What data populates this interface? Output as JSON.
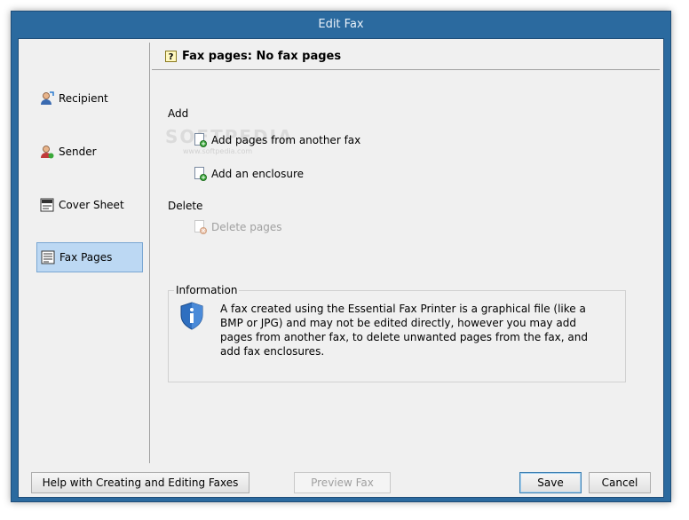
{
  "window": {
    "title": "Edit Fax"
  },
  "sidebar": {
    "items": [
      {
        "label": "Recipient",
        "icon": "recipient-icon",
        "selected": false
      },
      {
        "label": "Sender",
        "icon": "sender-icon",
        "selected": false
      },
      {
        "label": "Cover Sheet",
        "icon": "cover-sheet-icon",
        "selected": false
      },
      {
        "label": "Fax Pages",
        "icon": "fax-pages-icon",
        "selected": true
      }
    ]
  },
  "main": {
    "header": "Fax pages: No fax pages",
    "add_label": "Add",
    "actions_add": [
      {
        "label": "Add pages from another fax",
        "icon": "add-page-icon",
        "enabled": true
      },
      {
        "label": "Add an enclosure",
        "icon": "add-enclosure-icon",
        "enabled": true
      }
    ],
    "delete_label": "Delete",
    "actions_delete": [
      {
        "label": "Delete pages",
        "icon": "delete-page-icon",
        "enabled": false
      }
    ],
    "information": {
      "title": "Information",
      "text": "A fax created using the Essential Fax Printer is a graphical file (like a BMP or JPG) and may not be edited directly, however you may add pages from another fax, to delete unwanted pages from the fax, and add fax enclosures."
    }
  },
  "watermark": {
    "text": "SOFTPEDIA",
    "sub": "www.softpedia.com"
  },
  "buttons": {
    "help": "Help with Creating and Editing Faxes",
    "preview": "Preview Fax",
    "save": "Save",
    "cancel": "Cancel"
  },
  "colors": {
    "selection": "#bcd8f3",
    "titlebar": "#2b6a9f"
  }
}
